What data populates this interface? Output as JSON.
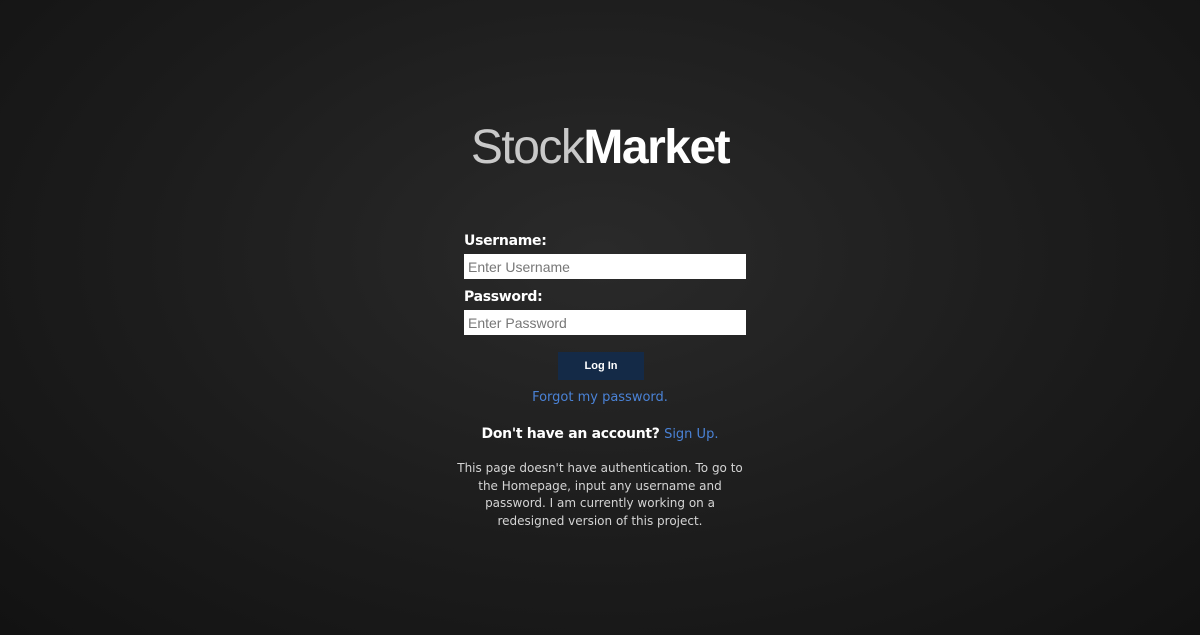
{
  "logo": {
    "part_light": "Stock",
    "part_bold": "Market"
  },
  "form": {
    "username_label": "Username:",
    "username_placeholder": "Enter Username",
    "username_value": "",
    "password_label": "Password:",
    "password_placeholder": "Enter Password",
    "password_value": "",
    "login_label": "Log In",
    "forgot_label": "Forgot my password."
  },
  "signup": {
    "question": "Don't have an account?",
    "link_label": "Sign Up."
  },
  "note": "This page doesn't have authentication. To go to the Homepage, input any username and password. I am currently working on a redesigned version of this project.",
  "colors": {
    "background": "#1c1c1c",
    "link": "#4a82d6",
    "button": "#142a47"
  }
}
